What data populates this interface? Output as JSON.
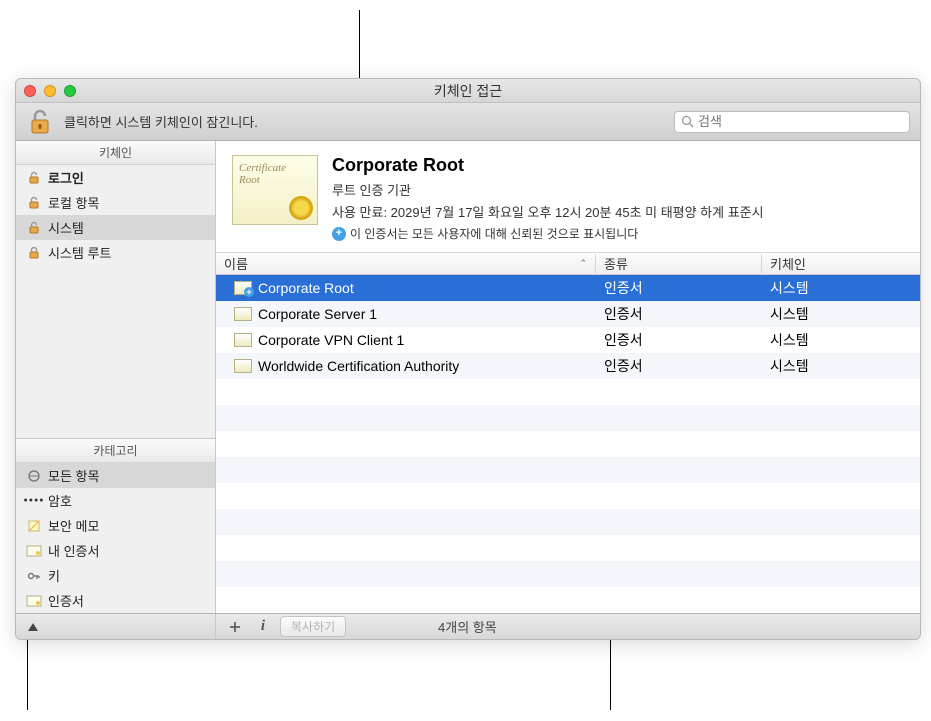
{
  "window": {
    "title": "키체인 접근",
    "lock_message": "클릭하면 시스템 키체인이 잠긴니다.",
    "search_placeholder": "검색"
  },
  "sidebar": {
    "keychains_header": "키체인",
    "keychains": [
      {
        "label": "로그인",
        "bold": true,
        "selected": false,
        "icon": "unlocked"
      },
      {
        "label": "로컬 항목",
        "bold": false,
        "selected": false,
        "icon": "unlocked"
      },
      {
        "label": "시스템",
        "bold": false,
        "selected": true,
        "icon": "unlocked"
      },
      {
        "label": "시스템 루트",
        "bold": false,
        "selected": false,
        "icon": "locked"
      }
    ],
    "categories_header": "카테고리",
    "categories": [
      {
        "label": "모든 항목",
        "selected": true,
        "icon": "all"
      },
      {
        "label": "암호",
        "selected": false,
        "icon": "dots"
      },
      {
        "label": "보안 메모",
        "selected": false,
        "icon": "note"
      },
      {
        "label": "내 인증서",
        "selected": false,
        "icon": "cert"
      },
      {
        "label": "키",
        "selected": false,
        "icon": "key"
      },
      {
        "label": "인증서",
        "selected": false,
        "icon": "cert"
      }
    ]
  },
  "detail": {
    "cert_badge_text": "Certificate",
    "cert_badge_sub": "Root",
    "title": "Corporate Root",
    "subtitle": "루트 인증 기관",
    "expiry": "사용 만료: 2029년 7월 17일 화요일 오후 12시 20분 45초 미 태평양 하계 표준시",
    "trust_message": "이 인증서는 모든 사용자에 대해 신뢰된 것으로 표시됩니다"
  },
  "table": {
    "columns": {
      "name": "이름",
      "kind": "종류",
      "keychain": "키체인"
    },
    "rows": [
      {
        "name": "Corporate Root",
        "kind": "인증서",
        "keychain": "시스템",
        "selected": true,
        "star": true
      },
      {
        "name": "Corporate Server 1",
        "kind": "인증서",
        "keychain": "시스템",
        "selected": false,
        "star": false
      },
      {
        "name": "Corporate VPN Client 1",
        "kind": "인증서",
        "keychain": "시스템",
        "selected": false,
        "star": false
      },
      {
        "name": "Worldwide Certification Authority",
        "kind": "인증서",
        "keychain": "시스템",
        "selected": false,
        "star": false
      }
    ]
  },
  "statusbar": {
    "copy_label": "복사하기",
    "count": "4개의 항목"
  }
}
